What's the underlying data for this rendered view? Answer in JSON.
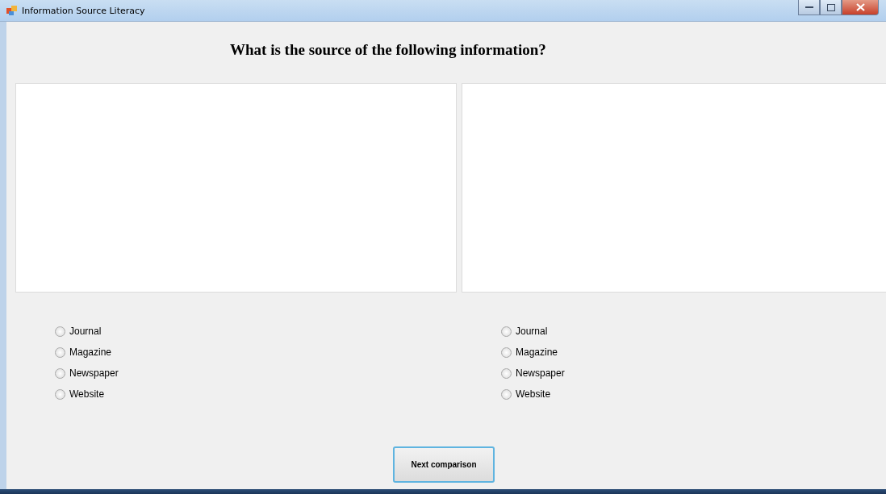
{
  "window": {
    "title": "Information Source Literacy"
  },
  "question": "What is the source of the following information?",
  "panels": [
    {
      "options": [
        {
          "label": "Journal",
          "selected": false
        },
        {
          "label": "Magazine",
          "selected": false
        },
        {
          "label": "Newspaper",
          "selected": false
        },
        {
          "label": "Website",
          "selected": false
        }
      ]
    },
    {
      "options": [
        {
          "label": "Journal",
          "selected": false
        },
        {
          "label": "Magazine",
          "selected": false
        },
        {
          "label": "Newspaper",
          "selected": false
        },
        {
          "label": "Website",
          "selected": false
        }
      ]
    }
  ],
  "button": "Next comparison"
}
